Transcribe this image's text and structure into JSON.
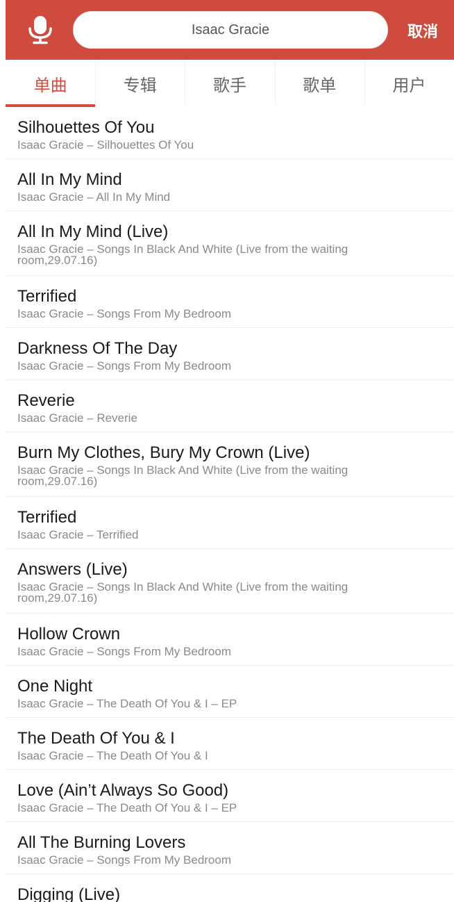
{
  "header": {
    "search_value": "Isaac Gracie",
    "cancel_label": "取消",
    "accent_color": "#cf4b3d",
    "mic_icon": "microphone-icon"
  },
  "tabs": [
    {
      "label": "单曲",
      "active": true
    },
    {
      "label": "专辑",
      "active": false
    },
    {
      "label": "歌手",
      "active": false
    },
    {
      "label": "歌单",
      "active": false
    },
    {
      "label": "用户",
      "active": false
    }
  ],
  "songs": [
    {
      "title": "Silhouettes Of You",
      "subtitle": "Isaac Gracie – Silhouettes Of You"
    },
    {
      "title": "All In My Mind",
      "subtitle": "Isaac Gracie – All In My Mind"
    },
    {
      "title": "All In My Mind (Live)",
      "subtitle": "Isaac Gracie – Songs In Black And White (Live from the waiting room,29.07.16)"
    },
    {
      "title": "Terrified",
      "subtitle": "Isaac Gracie – Songs From My Bedroom"
    },
    {
      "title": "Darkness Of The Day",
      "subtitle": "Isaac Gracie – Songs From My Bedroom"
    },
    {
      "title": "Reverie",
      "subtitle": "Isaac Gracie – Reverie"
    },
    {
      "title": "Burn My Clothes, Bury My Crown (Live)",
      "subtitle": "Isaac Gracie – Songs In Black And White (Live from the waiting room,29.07.16)"
    },
    {
      "title": "Terrified",
      "subtitle": "Isaac Gracie – Terrified"
    },
    {
      "title": "Answers (Live)",
      "subtitle": "Isaac Gracie – Songs In Black And White (Live from the waiting room,29.07.16)"
    },
    {
      "title": "Hollow Crown",
      "subtitle": "Isaac Gracie – Songs From My Bedroom"
    },
    {
      "title": "One Night",
      "subtitle": "Isaac Gracie – The Death Of You & I – EP"
    },
    {
      "title": "The Death Of You & I",
      "subtitle": "Isaac Gracie – The Death Of You & I"
    },
    {
      "title": "Love (Ain’t Always So Good)",
      "subtitle": "Isaac Gracie – The Death Of You & I – EP"
    },
    {
      "title": "All The Burning Lovers",
      "subtitle": "Isaac Gracie – Songs From My Bedroom"
    },
    {
      "title": "Digging (Live)",
      "subtitle": ""
    }
  ]
}
